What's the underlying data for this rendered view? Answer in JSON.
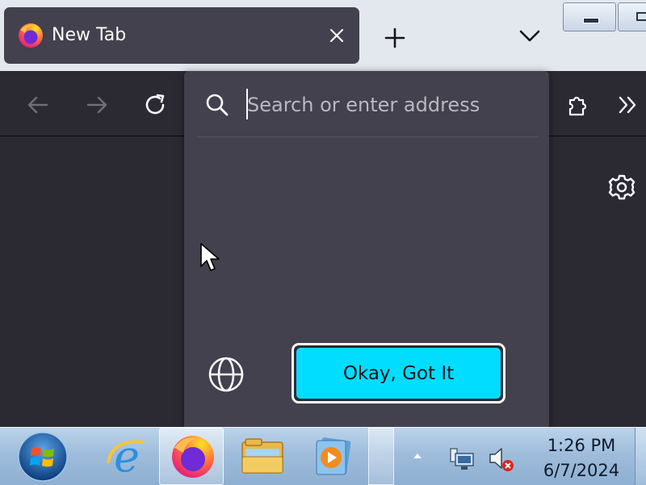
{
  "browser": {
    "tab": {
      "title": "New Tab",
      "favicon": "firefox-icon",
      "close_icon": "close-icon"
    },
    "tabstrip": {
      "new_tab_icon": "plus-icon",
      "list_tabs_icon": "chevron-down-icon"
    },
    "window_controls": [
      "minimize",
      "restore"
    ],
    "toolbar": {
      "back_icon": "arrow-left-icon",
      "forward_icon": "arrow-right-icon",
      "reload_icon": "reload-icon",
      "extensions_icon": "puzzle-icon",
      "overflow_icon": "double-chevron-icon"
    },
    "urlbar": {
      "value": "",
      "placeholder": "Search or enter address",
      "search_icon": "search-icon",
      "globe_icon": "globe-icon",
      "confirm_button": "Okay, Got It"
    },
    "content": {
      "settings_icon": "gear-icon"
    }
  },
  "taskbar": {
    "start": "windows-start-orb",
    "pinned": [
      {
        "name": "internet-explorer-icon",
        "active": false
      },
      {
        "name": "firefox-icon",
        "active": true
      },
      {
        "name": "file-explorer-icon",
        "active": false
      },
      {
        "name": "media-player-icon",
        "active": false
      }
    ],
    "tray": {
      "show_hidden_icon": "caret-up-icon",
      "network_icon": "network-icon",
      "volume_icon": "volume-muted-icon"
    },
    "clock": {
      "time": "1:26 PM",
      "date": "6/7/2024"
    }
  },
  "colors": {
    "tab_active": "#42414d",
    "toolbar": "#2b2a33",
    "accent": "#00ddff",
    "tabstrip": "#e3e8ef"
  }
}
